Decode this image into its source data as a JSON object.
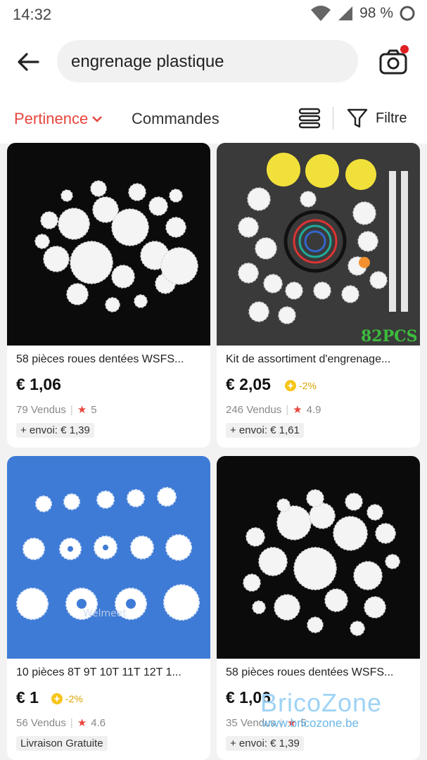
{
  "status_bar": {
    "time": "14:32",
    "battery": "98 %"
  },
  "search": {
    "query": "engrenage plastique"
  },
  "sort": {
    "relevance": "Pertinence",
    "orders": "Commandes",
    "filter": "Filtre"
  },
  "products": [
    {
      "title": "58 pièces roues dentées WSFS...",
      "price": "€ 1,06",
      "discount": "",
      "sold": "79 Vendus",
      "rating": "5",
      "shipping": "+ envoi: € 1,39"
    },
    {
      "title": "Kit de assortiment d'engrenage...",
      "price": "€ 2,05",
      "discount": "-2%",
      "sold": "246 Vendus",
      "rating": "4.9",
      "shipping": "+ envoi: € 1,61",
      "image_label": "82PCS"
    },
    {
      "title": "10 pièces 8T 9T 10T 11T 12T 1...",
      "price": "€ 1",
      "discount": "-2%",
      "sold": "56 Vendus",
      "rating": "4.6",
      "shipping": "Livraison  Gratuite",
      "image_label": "Welmeet"
    },
    {
      "title": "58 pièces roues dentées WSFS...",
      "price": "€ 1,06",
      "discount": "",
      "sold": "35 Vendus",
      "rating": "5",
      "shipping": "+ envoi: € 1,39"
    }
  ],
  "watermark": {
    "name": "BricoZone",
    "url": "www.bricozone.be"
  },
  "colors": {
    "accent": "#e8453c",
    "coin": "#f5c518",
    "blue_bg": "#3e7bd6",
    "dark_bg": "#111111"
  }
}
